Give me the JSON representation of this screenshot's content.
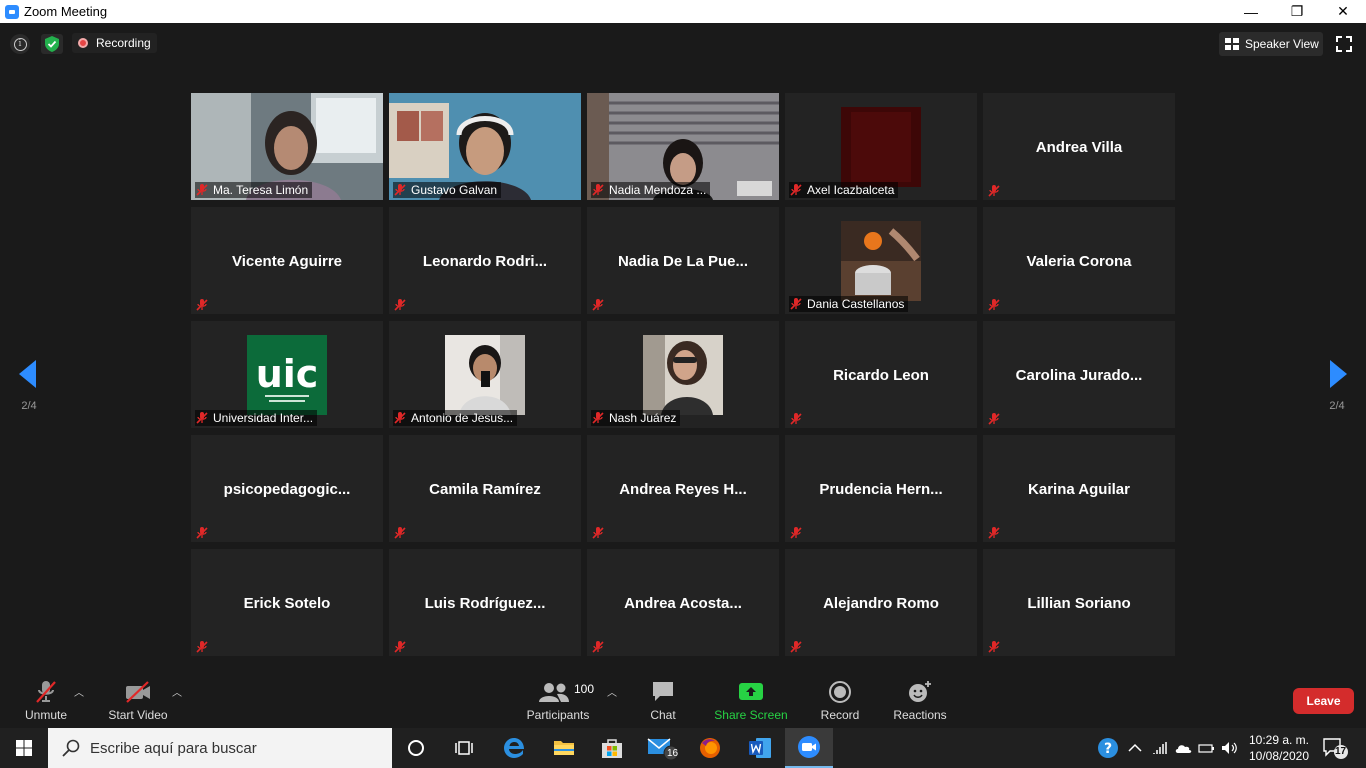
{
  "window": {
    "title": "Zoom Meeting",
    "minimize": "—",
    "maximize": "❐",
    "close": "✕"
  },
  "topbar": {
    "recording_label": "Recording",
    "speaker_view_label": "Speaker View"
  },
  "pager": {
    "left_page": "2/4",
    "right_page": "2/4"
  },
  "tiles": [
    {
      "name": "Ma. Teresa Limón",
      "type": "video"
    },
    {
      "name": "Gustavo Galvan",
      "type": "video"
    },
    {
      "name": "Nadia Mendoza ...",
      "type": "video"
    },
    {
      "name": "Axel Icazbalceta",
      "type": "photo"
    },
    {
      "name": "Andrea Villa",
      "type": "name"
    },
    {
      "name": "Vicente Aguirre",
      "type": "name"
    },
    {
      "name": "Leonardo  Rodri...",
      "type": "name"
    },
    {
      "name": "Nadia De La Pue...",
      "type": "name"
    },
    {
      "name": "Dania Castellanos",
      "type": "photo"
    },
    {
      "name": "Valeria Corona",
      "type": "name"
    },
    {
      "name": "Universidad Inter...",
      "type": "photo",
      "logo_text": "uic"
    },
    {
      "name": "Antonio de Jesus...",
      "type": "photo"
    },
    {
      "name": "Nash  Juárez",
      "type": "photo"
    },
    {
      "name": "Ricardo Leon",
      "type": "name"
    },
    {
      "name": "Carolina  Jurado...",
      "type": "name"
    },
    {
      "name": "psicopedagogic...",
      "type": "name"
    },
    {
      "name": "Camila Ramírez",
      "type": "name"
    },
    {
      "name": "Andrea Reyes H...",
      "type": "name"
    },
    {
      "name": "Prudencia  Hern...",
      "type": "name"
    },
    {
      "name": "Karina Aguilar",
      "type": "name"
    },
    {
      "name": "Erick Sotelo",
      "type": "name"
    },
    {
      "name": "Luis  Rodríguez...",
      "type": "name"
    },
    {
      "name": "Andrea  Acosta...",
      "type": "name"
    },
    {
      "name": "Alejandro Romo",
      "type": "name"
    },
    {
      "name": "Lillian Soriano",
      "type": "name"
    }
  ],
  "toolbar": {
    "unmute": "Unmute",
    "start_video": "Start Video",
    "participants": "Participants",
    "participants_count": "100",
    "chat": "Chat",
    "share_screen": "Share Screen",
    "record": "Record",
    "reactions": "Reactions",
    "leave": "Leave"
  },
  "taskbar": {
    "search_placeholder": "Escribe aquí para buscar",
    "mail_badge": "16",
    "time": "10:29 a. m.",
    "date": "10/08/2020",
    "notifications": "17"
  },
  "colors": {
    "accent": "#2d8cff",
    "share_green": "#27d244",
    "leave_red": "#d42c2c",
    "mute_red": "#e02828"
  }
}
